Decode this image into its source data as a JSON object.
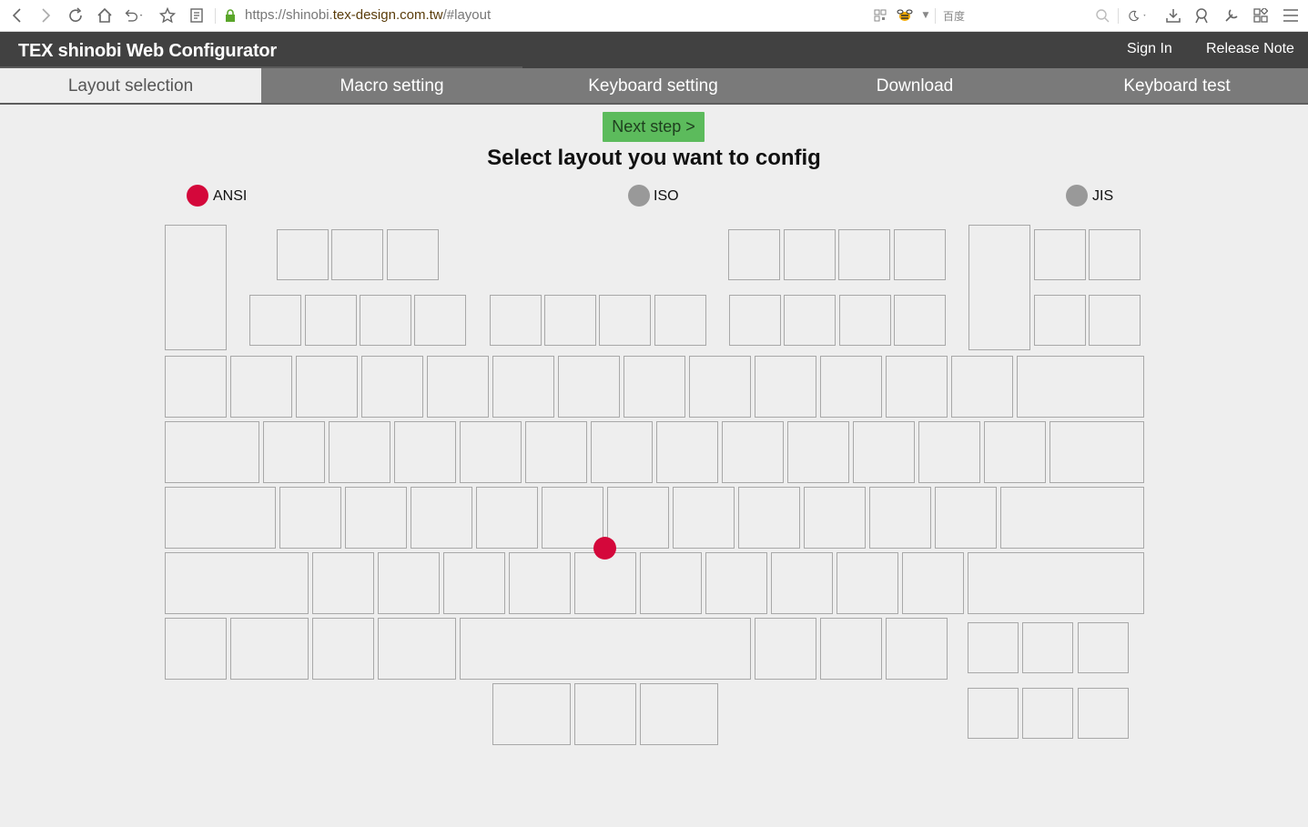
{
  "browser": {
    "url_prefix": "https://shinobi.",
    "url_domain": "tex-design.com.tw",
    "url_suffix": "/#layout",
    "search_placeholder": "百度"
  },
  "app": {
    "title": "TEX shinobi Web Configurator",
    "sign_in": "Sign In",
    "release_note": "Release Note"
  },
  "tabs": [
    {
      "label": "Layout selection",
      "active": true
    },
    {
      "label": "Macro setting",
      "active": false
    },
    {
      "label": "Keyboard setting",
      "active": false
    },
    {
      "label": "Download",
      "active": false
    },
    {
      "label": "Keyboard test",
      "active": false
    }
  ],
  "main": {
    "next_button": "Next step >",
    "heading": "Select layout you want to config",
    "layouts": [
      {
        "label": "ANSI",
        "selected": true
      },
      {
        "label": "ISO",
        "selected": false
      },
      {
        "label": "JIS",
        "selected": false
      }
    ]
  },
  "colors": {
    "accent_red": "#d4083b",
    "radio_off": "#999999",
    "next_green": "#5cbb5c",
    "header_bg": "#414141",
    "tab_bg": "#7a7a7a"
  }
}
